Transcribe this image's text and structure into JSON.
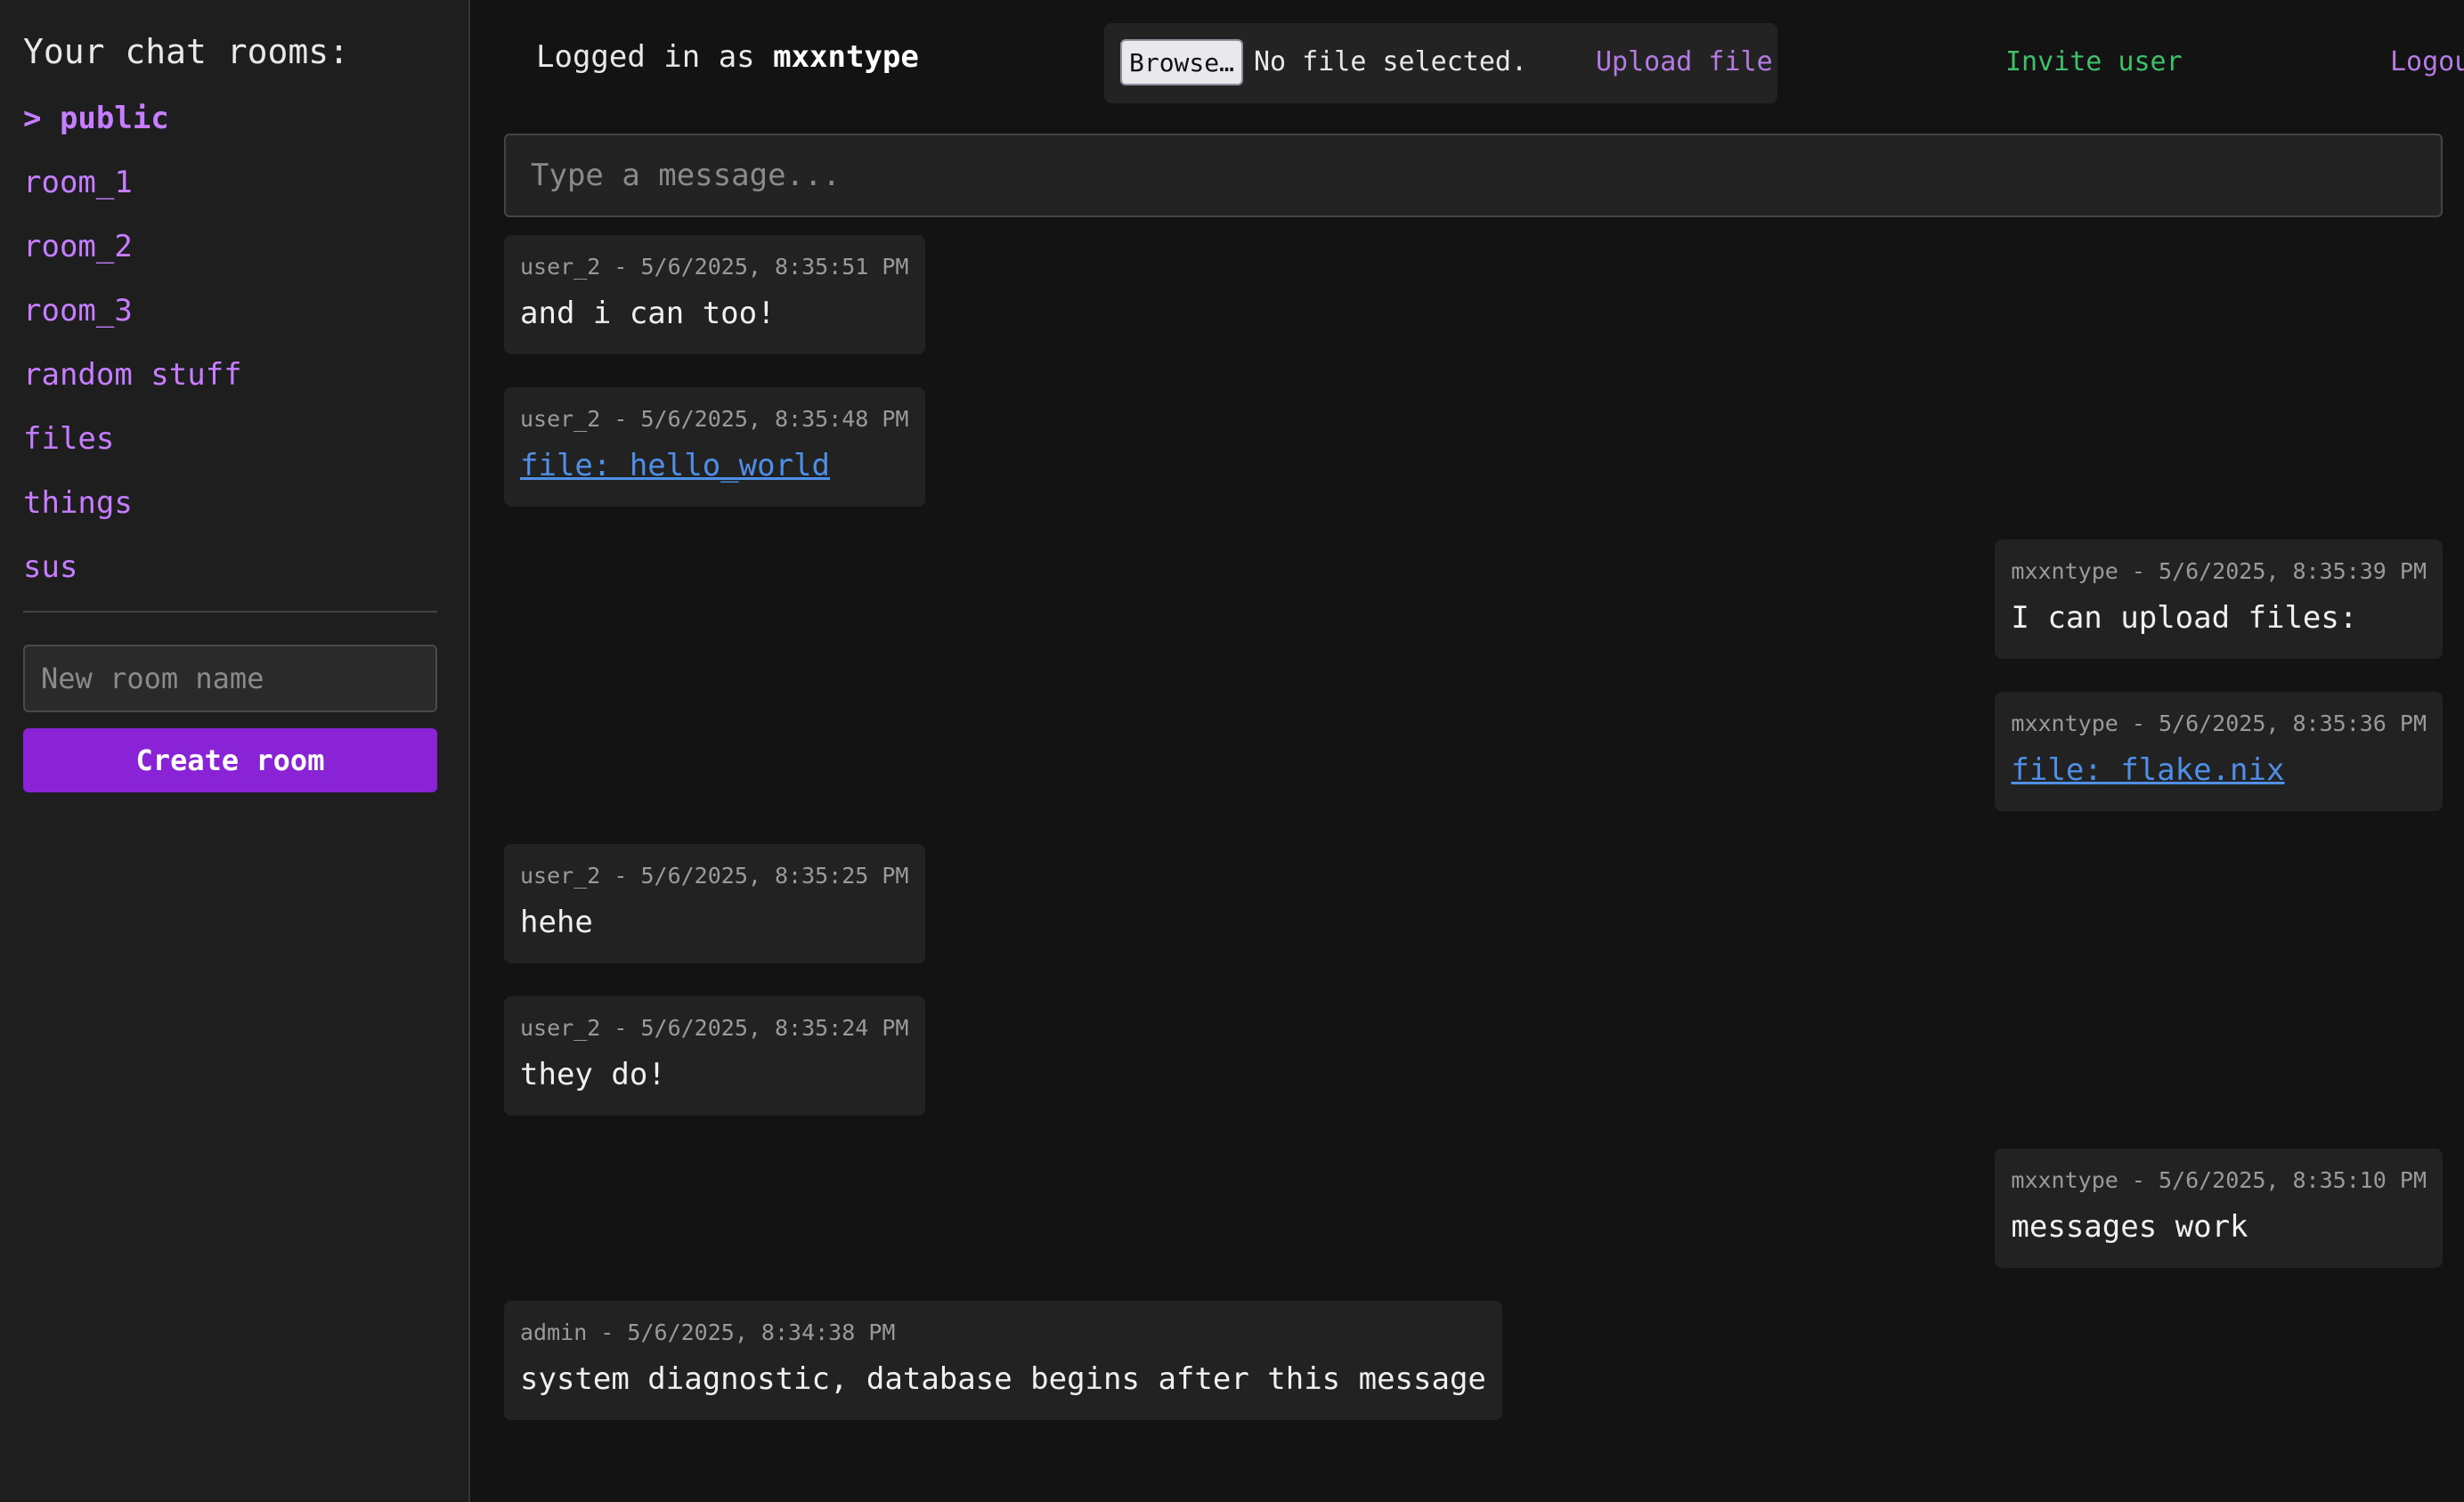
{
  "sidebar": {
    "title": "Your chat rooms:",
    "rooms": [
      {
        "label": "> public",
        "active": true
      },
      {
        "label": "room_1"
      },
      {
        "label": "room_2"
      },
      {
        "label": "room_3"
      },
      {
        "label": "random stuff"
      },
      {
        "label": "files"
      },
      {
        "label": "things"
      },
      {
        "label": "sus"
      }
    ],
    "new_room_placeholder": "New room name",
    "create_room_label": "Create room"
  },
  "header": {
    "logged_in_prefix": "Logged in as ",
    "username": "mxxntype",
    "browse_label": "Browse…",
    "no_file_text": "No file selected.",
    "upload_label": "Upload file",
    "invite_label": "Invite user",
    "logout_label": "Logout"
  },
  "composer": {
    "placeholder": "Type a message..."
  },
  "messages": [
    {
      "meta": "user_2 - 5/6/2025, 8:35:51 PM",
      "text": "and i can too!",
      "side": "left"
    },
    {
      "meta": "user_2 - 5/6/2025, 8:35:48 PM",
      "link": "file: hello_world",
      "side": "left"
    },
    {
      "meta": "mxxntype - 5/6/2025, 8:35:39 PM",
      "text": "I can upload files:",
      "side": "right"
    },
    {
      "meta": "mxxntype - 5/6/2025, 8:35:36 PM",
      "link": "file: flake.nix",
      "side": "right"
    },
    {
      "meta": "user_2 - 5/6/2025, 8:35:25 PM",
      "text": "hehe",
      "side": "left"
    },
    {
      "meta": "user_2 - 5/6/2025, 8:35:24 PM",
      "text": "they do!",
      "side": "left"
    },
    {
      "meta": "mxxntype - 5/6/2025, 8:35:10 PM",
      "text": "messages work",
      "side": "right"
    },
    {
      "meta": "admin - 5/6/2025, 8:34:38 PM",
      "text": "system diagnostic, database begins after this message",
      "side": "left"
    }
  ],
  "colors": {
    "accent": "#8a22d6",
    "link_purple": "#c77dff",
    "invite_green": "#3fbf6a",
    "file_link_blue": "#4f8fe8"
  }
}
